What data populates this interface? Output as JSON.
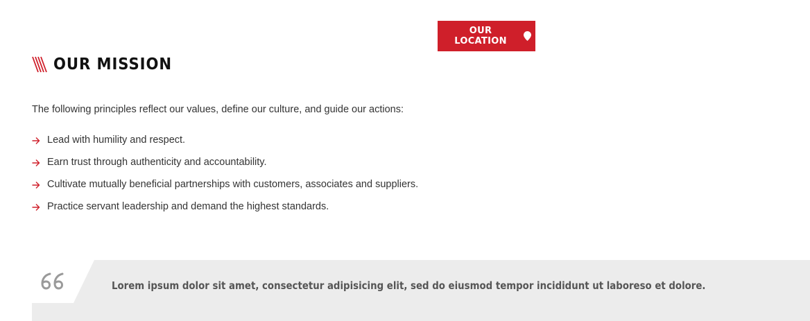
{
  "header": {
    "location_button_label": "OUR LOCATION",
    "location_icon": "map-pin-icon"
  },
  "mission": {
    "title": "OUR MISSION",
    "title_icon": "diagonal-stripes-icon",
    "intro": "The following principles reflect our values, define our culture, and guide our actions:",
    "bullet_icon": "arrow-right-icon",
    "principles": [
      "Lead with humility and respect.",
      "Earn trust through authenticity and accountability.",
      "Cultivate mutually beneficial partnerships with customers, associates and suppliers.",
      "Practice servant leadership and demand the highest standards."
    ]
  },
  "quote": {
    "icon": "quote-icon",
    "text": "Lorem ipsum dolor sit amet, consectetur adipisicing elit, sed do eiusmod tempor incididunt ut laboreso et dolore."
  },
  "colors": {
    "accent": "#cf1f2a",
    "band": "#ececec",
    "text": "#333333"
  }
}
